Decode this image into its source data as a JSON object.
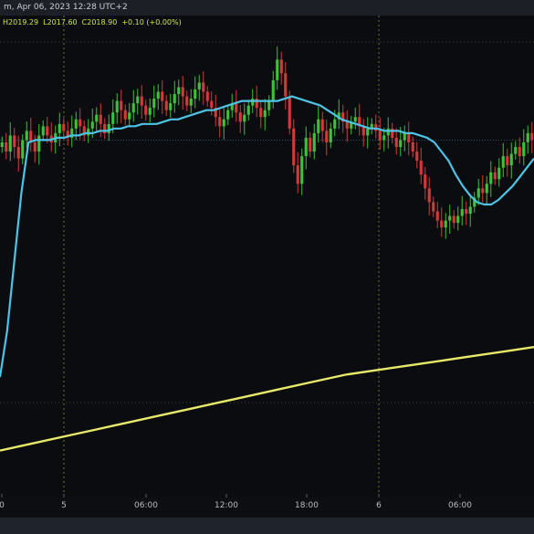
{
  "header": {
    "title_text": "m, Apr 06, 2023 12:28 UTC+2"
  },
  "legend": {
    "high": "H2019.29",
    "low": "L2017.60",
    "close": "C2018.90",
    "change": "+0.10 (+0.00%)"
  },
  "colors": {
    "background": "#0b0c0f",
    "up_candle": "#3fbf3a",
    "down_candle": "#d23a3a",
    "fast_ma": "#4fc3e6",
    "slow_ma": "#e8e86a",
    "grid_dotted": "#8a8a3a",
    "price_line": "#3a6fa0"
  },
  "chart_data": {
    "type": "candlestick",
    "x_tick_labels": [
      "0",
      "5",
      "06:00",
      "12:00",
      "18:00",
      "6",
      "06:00"
    ],
    "x_range": [
      0,
      585
    ],
    "ylim": [
      2017.4,
      2019.4
    ],
    "grid": true,
    "vertical_gridlines_at_ticks": [
      "5",
      "6"
    ],
    "candles_close": [
      2018.92,
      2018.88,
      2018.95,
      2018.9,
      2018.85,
      2018.93,
      2018.97,
      2018.92,
      2018.88,
      2018.95,
      2018.99,
      2018.95,
      2018.92,
      2018.96,
      2019.0,
      2018.97,
      2018.94,
      2018.98,
      2019.02,
      2018.99,
      2018.95,
      2018.98,
      2019.01,
      2019.04,
      2019.0,
      2018.96,
      2019.0,
      2019.05,
      2019.1,
      2019.06,
      2019.02,
      2019.05,
      2019.09,
      2019.12,
      2019.08,
      2019.04,
      2019.07,
      2019.11,
      2019.14,
      2019.1,
      2019.06,
      2019.09,
      2019.13,
      2019.16,
      2019.12,
      2019.08,
      2019.11,
      2019.15,
      2019.18,
      2019.14,
      2019.1,
      2019.07,
      2019.03,
      2018.99,
      2019.02,
      2019.06,
      2019.09,
      2019.05,
      2019.01,
      2019.04,
      2019.08,
      2019.11,
      2019.07,
      2019.03,
      2019.06,
      2019.1,
      2019.19,
      2019.28,
      2019.22,
      2019.12,
      2018.98,
      2018.82,
      2018.74,
      2018.86,
      2018.94,
      2018.88,
      2018.96,
      2019.02,
      2018.97,
      2018.92,
      2018.98,
      2019.02,
      2019.05,
      2019.01,
      2018.98,
      2019.01,
      2019.03,
      2018.99,
      2018.95,
      2018.98,
      2019.0,
      2018.97,
      2018.93,
      2018.95,
      2018.98,
      2018.94,
      2018.9,
      2018.93,
      2018.96,
      2018.92,
      2018.88,
      2018.84,
      2018.78,
      2018.72,
      2018.66,
      2018.62,
      2018.58,
      2018.55,
      2018.58,
      2018.6,
      2018.57,
      2018.6,
      2018.63,
      2018.61,
      2018.64,
      2018.68,
      2018.72,
      2018.7,
      2018.74,
      2018.79,
      2018.76,
      2018.81,
      2018.86,
      2018.82,
      2018.87,
      2018.9,
      2018.86,
      2018.92,
      2018.96,
      2018.93
    ],
    "fast_ma": [
      2017.9,
      2018.1,
      2018.4,
      2018.7,
      2018.92,
      2018.93,
      2018.93,
      2018.93,
      2018.94,
      2018.94,
      2018.95,
      2018.95,
      2018.96,
      2018.96,
      2018.97,
      2018.97,
      2018.98,
      2018.98,
      2018.99,
      2018.99,
      2019.0,
      2019.0,
      2019.0,
      2019.01,
      2019.02,
      2019.02,
      2019.03,
      2019.04,
      2019.05,
      2019.06,
      2019.06,
      2019.07,
      2019.08,
      2019.09,
      2019.1,
      2019.1,
      2019.1,
      2019.1,
      2019.1,
      2019.1,
      2019.11,
      2019.12,
      2019.11,
      2019.1,
      2019.09,
      2019.08,
      2019.06,
      2019.04,
      2019.02,
      2019.01,
      2019.0,
      2018.99,
      2018.98,
      2018.98,
      2018.97,
      2018.97,
      2018.97,
      2018.96,
      2018.96,
      2018.95,
      2018.94,
      2018.92,
      2018.88,
      2018.84,
      2018.78,
      2018.73,
      2018.69,
      2018.66,
      2018.65,
      2018.65,
      2018.67,
      2018.7,
      2018.73,
      2018.77,
      2018.81,
      2018.85
    ],
    "slow_ma": [
      2017.58,
      2017.61,
      2017.64,
      2017.67,
      2017.7,
      2017.73,
      2017.76,
      2017.79,
      2017.82,
      2017.85,
      2017.88,
      2017.91,
      2017.93,
      2017.95,
      2017.97,
      2017.99,
      2018.01,
      2018.03
    ]
  }
}
